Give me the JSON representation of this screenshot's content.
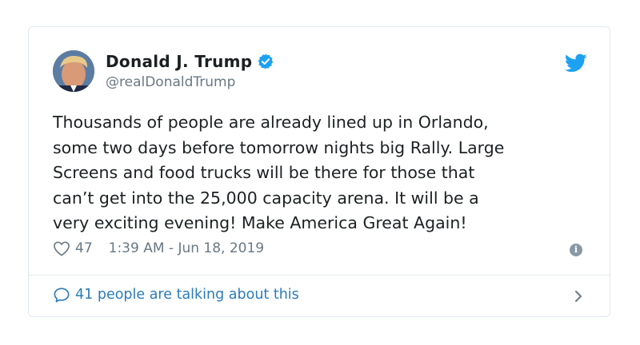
{
  "author": {
    "name": "Donald J. Trump",
    "handle": "@realDonaldTrump",
    "verified_icon": "verified-badge-icon"
  },
  "tweet": {
    "text": "Thousands of people are already lined up in Orlando,\nsome two days before tomorrow nights big Rally. Large\nScreens and food trucks will be there for those that\ncan’t get into the 25,000 capacity arena. It will be a\nvery exciting evening! Make America Great Again!",
    "likes": "47",
    "timestamp": "1:39 AM - Jun 18, 2019"
  },
  "footer": {
    "talking": "41 people are talking about this"
  },
  "colors": {
    "twitter_blue": "#1da1f2",
    "link_blue": "#2b7bb9",
    "muted": "#697882",
    "border": "#e1e8ed"
  }
}
